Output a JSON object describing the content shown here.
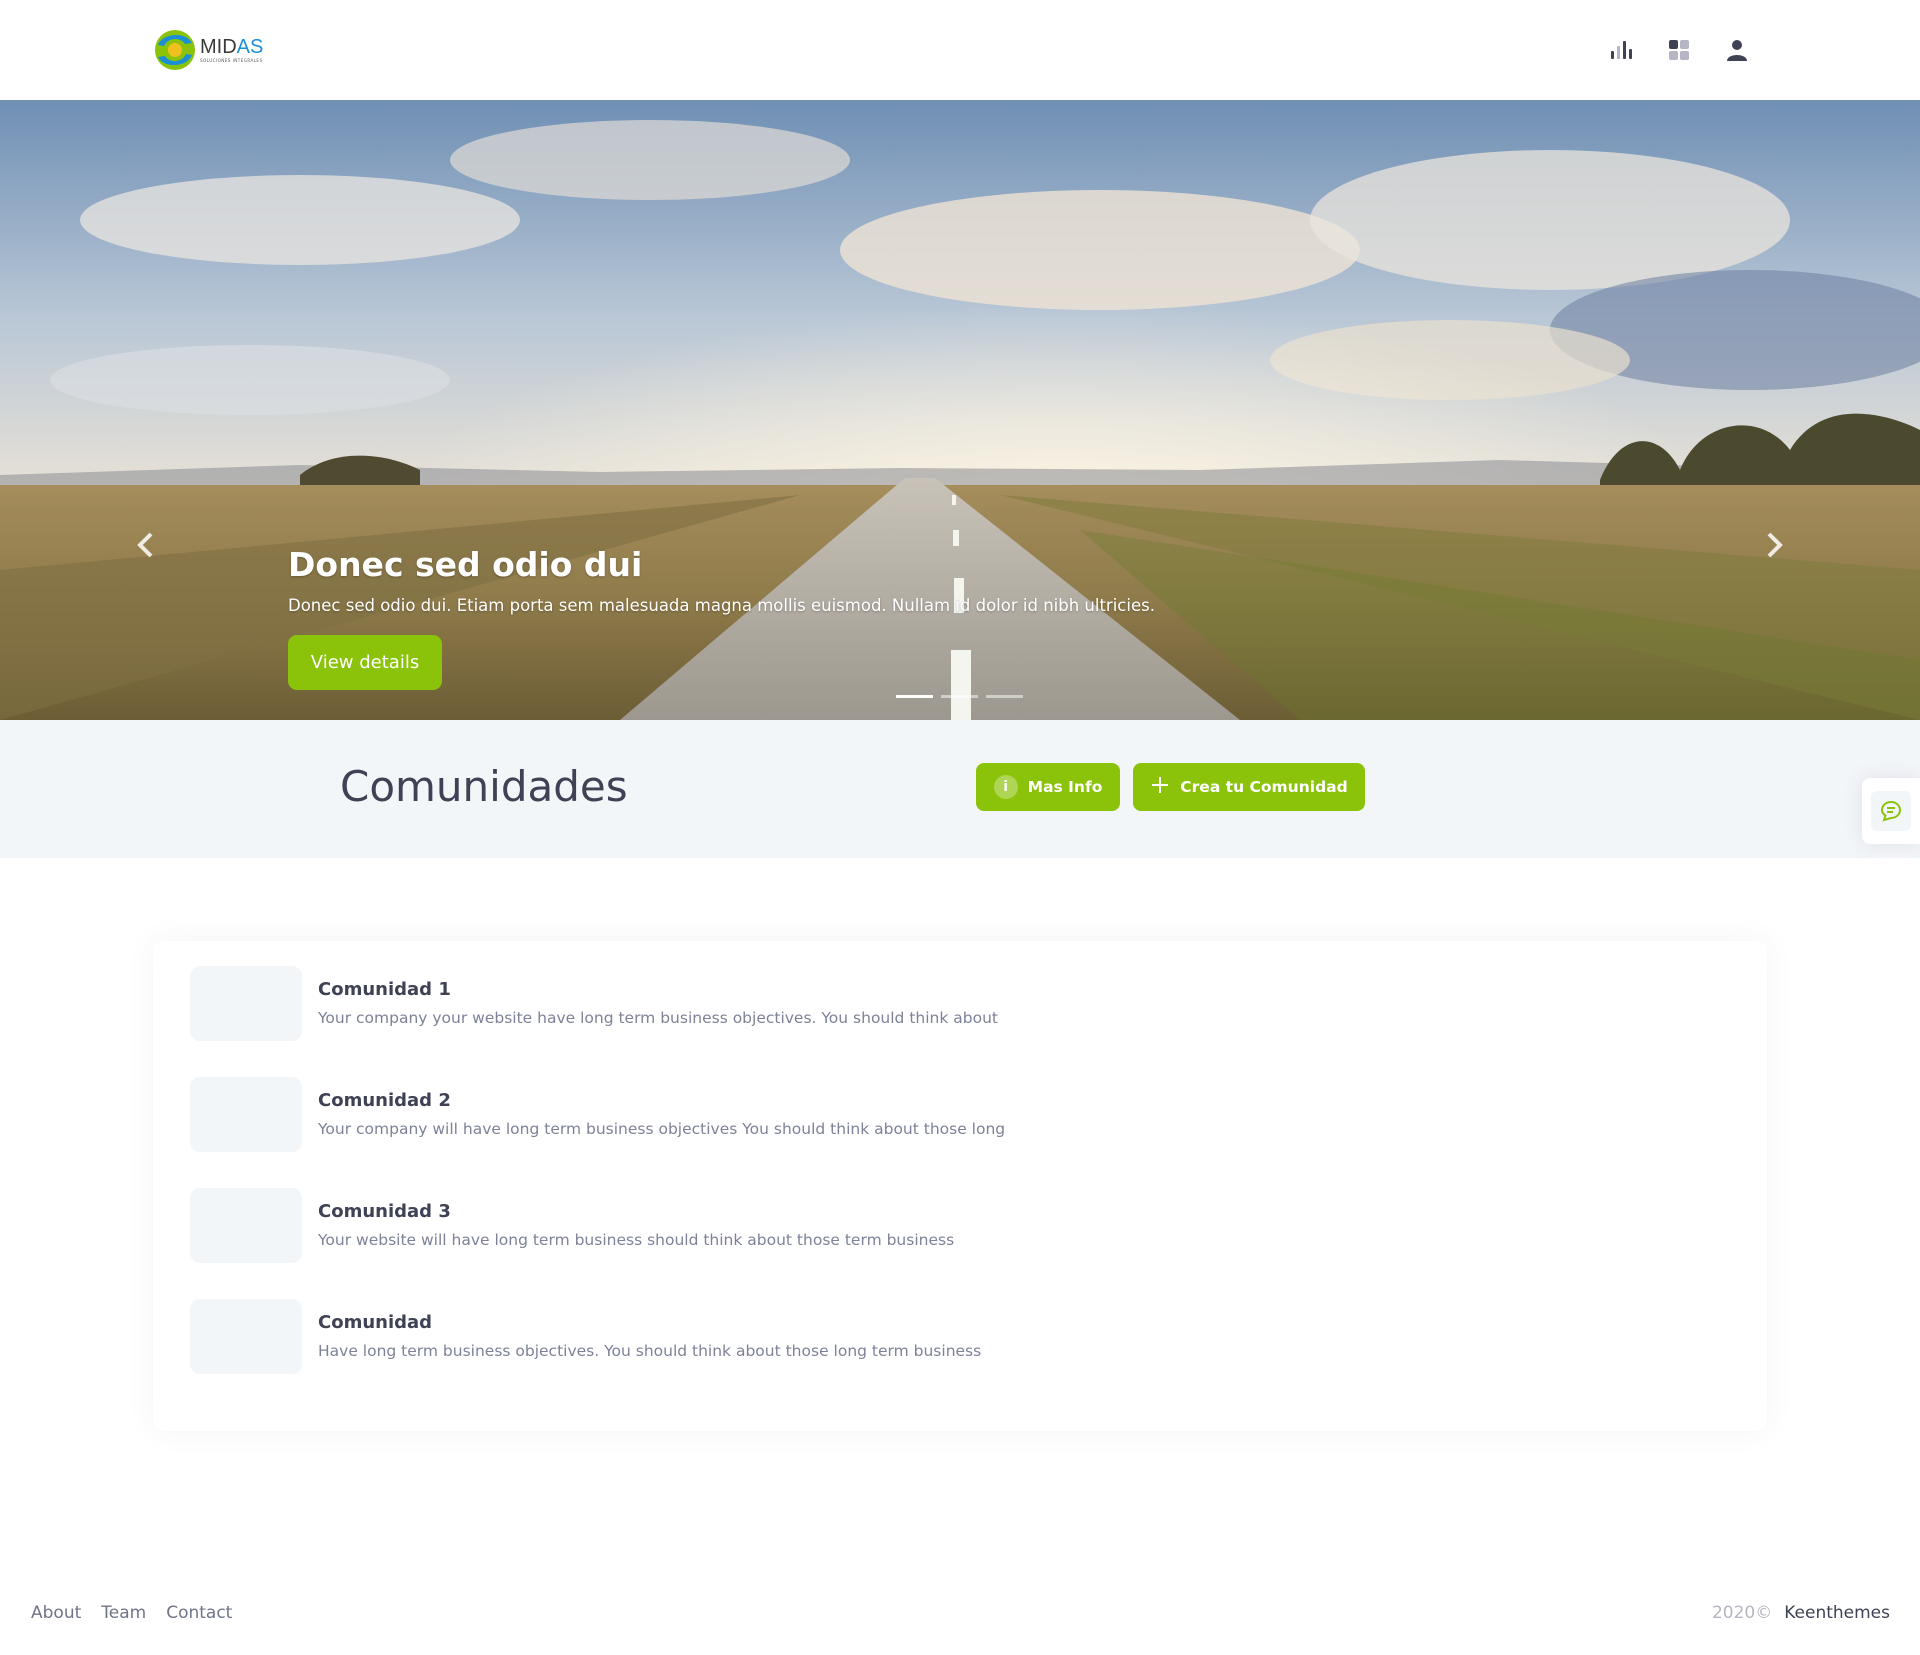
{
  "header": {
    "logo": {
      "word_left": "MID",
      "word_right": "AS",
      "tagline": "SOLUCIONES INTEGRALES"
    },
    "icons": [
      "bar-chart-icon",
      "apps-grid-icon",
      "user-icon"
    ]
  },
  "hero": {
    "title": "Donec sed odio dui",
    "subtitle": "Donec sed odio dui. Etiam porta sem malesuada magna mollis euismod. Nullam id dolor id nibh ultricies.",
    "button_label": "View details",
    "slides_count": 3,
    "active_slide": 1
  },
  "subheader": {
    "title": "Comunidades",
    "info_button": {
      "icon_glyph": "i",
      "label": "Mas Info"
    },
    "create_button": {
      "icon_glyph": "+",
      "label": "Crea tu Comunidad"
    }
  },
  "communities": [
    {
      "title": "Comunidad 1",
      "description": "Your company your website have long term business objectives. You should think about"
    },
    {
      "title": "Comunidad 2",
      "description": "Your company will have long term business objectives You should think about those long"
    },
    {
      "title": "Comunidad 3",
      "description": "Your website will have long term business should think about those term business"
    },
    {
      "title": "Comunidad",
      "description": "Have long term business objectives. You should think about those long term business"
    }
  ],
  "footer": {
    "links": [
      "About",
      "Team",
      "Contact"
    ],
    "year": "2020©",
    "brand": "Keenthemes"
  },
  "colors": {
    "accent": "#8bc30a",
    "text_dark": "#3f4254",
    "text_muted": "#7e8299",
    "light_bg": "#f3f6f9"
  }
}
